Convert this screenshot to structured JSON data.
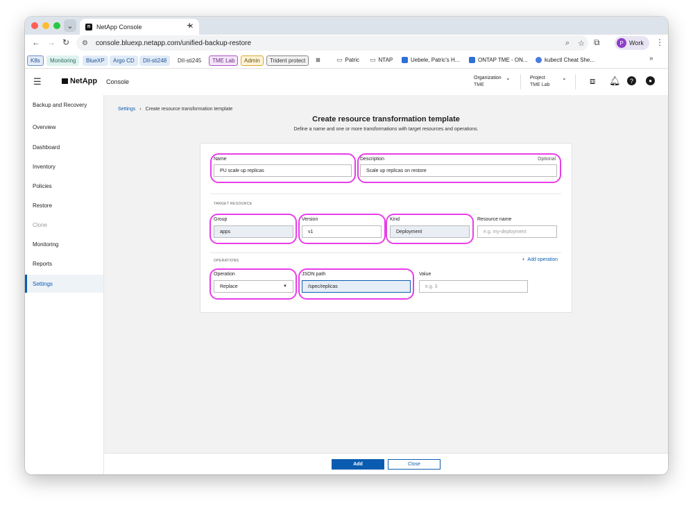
{
  "browser": {
    "tab_title": "NetApp Console",
    "url": "console.bluexp.netapp.com/unified-backup-restore",
    "profile_initial": "P",
    "profile_name": "Work"
  },
  "bookmarks": {
    "chips": [
      {
        "label": "K8s",
        "bg": "#e3ecf7",
        "border": "#6a8fc4",
        "color": "#1f4f8f"
      },
      {
        "label": "Monitoring",
        "bg": "#dff2ee",
        "border": "#dff2ee",
        "color": "#2c6b5e"
      },
      {
        "label": "BlueXP",
        "bg": "#e0ebf8",
        "border": "#e0ebf8",
        "color": "#1f4f8f"
      },
      {
        "label": "Argo CD",
        "bg": "#e0ebf8",
        "border": "#e0ebf8",
        "color": "#1f4f8f"
      },
      {
        "label": "DII-sti248",
        "bg": "#e0ebf8",
        "border": "#e0ebf8",
        "color": "#1f4f8f"
      },
      {
        "label": "DII-sti245",
        "bg": "#ffffff",
        "border": "#ffffff",
        "color": "#333333"
      },
      {
        "label": "TME Lab",
        "bg": "#f3e5f8",
        "border": "#b150c9",
        "color": "#6c2a80"
      },
      {
        "label": "Admin",
        "bg": "#fdf3d9",
        "border": "#d9a82a",
        "color": "#6b4e00"
      },
      {
        "label": "Trident protect",
        "bg": "#f1f1f1",
        "border": "#888888",
        "color": "#333333"
      }
    ],
    "links": [
      "Patric",
      "NTAP",
      "Uebele, Patric's H...",
      "ONTAP TME - ON...",
      "kubectl Cheat She..."
    ]
  },
  "header": {
    "brand": "NetApp",
    "product": "Console",
    "org_label": "Organization",
    "org_value": "TME",
    "project_label": "Project",
    "project_value": "TME Lab"
  },
  "sidebar": {
    "section": "Backup and Recovery",
    "items": [
      {
        "label": "Overview",
        "state": "normal"
      },
      {
        "label": "Dashboard",
        "state": "normal"
      },
      {
        "label": "Inventory",
        "state": "normal"
      },
      {
        "label": "Policies",
        "state": "normal"
      },
      {
        "label": "Restore",
        "state": "normal"
      },
      {
        "label": "Clone",
        "state": "disabled"
      },
      {
        "label": "Monitoring",
        "state": "normal"
      },
      {
        "label": "Reports",
        "state": "normal"
      },
      {
        "label": "Settings",
        "state": "active"
      }
    ]
  },
  "page": {
    "breadcrumb_root": "Settings",
    "breadcrumb_sep": "›",
    "breadcrumb_current": "Create resource transformation template",
    "title": "Create resource transformation template",
    "subtitle": "Define a name and one or more transformations with target resources and operations."
  },
  "form": {
    "name_label": "Name",
    "name_value": "PU scale up replicas",
    "description_label": "Description",
    "description_optional": "Optional",
    "description_value": "Scale up replicas on restore",
    "target_section": "TARGET RESOURCE",
    "group_label": "Group",
    "group_value": "apps",
    "version_label": "Version",
    "version_value": "v1",
    "kind_label": "Kind",
    "kind_value": "Deployment",
    "resource_name_label": "Resource name",
    "resource_name_placeholder": "e.g. my-deployment",
    "operations_section": "OPERATIONS",
    "add_operation": "Add operation",
    "operation_label": "Operation",
    "operation_value": "Replace",
    "json_path_label": "JSON path",
    "json_path_value": "/spec/replicas",
    "value_label": "Value",
    "value_placeholder": "e.g. 3"
  },
  "footer": {
    "add_label": "Add",
    "close_label": "Close"
  },
  "colors": {
    "accent": "#0a5cb0",
    "highlight": "#e83de8"
  }
}
